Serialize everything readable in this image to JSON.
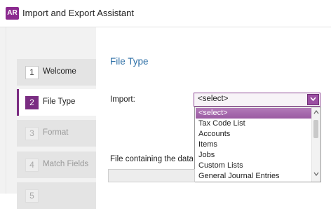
{
  "window": {
    "icon_text": "AR",
    "title": "Import and Export Assistant"
  },
  "sidebar": {
    "steps": [
      {
        "num": "1",
        "label": "Welcome",
        "state": "normal"
      },
      {
        "num": "2",
        "label": "File Type",
        "state": "active"
      },
      {
        "num": "3",
        "label": "Format",
        "state": "disabled"
      },
      {
        "num": "4",
        "label": "Match Fields",
        "state": "disabled"
      },
      {
        "num": "5",
        "label": "",
        "state": "disabled"
      }
    ]
  },
  "main": {
    "title": "File Type",
    "import_label": "Import:",
    "import_select": {
      "value": "<select>",
      "options": [
        "<select>",
        "Tax Code List",
        "Accounts",
        "Items",
        "Jobs",
        "Custom Lists",
        "General Journal Entries"
      ],
      "selected_index": 0
    },
    "file_label": "File containing the data y"
  },
  "colors": {
    "accent": "#7a2d82",
    "title_blue": "#2d6fa6"
  }
}
